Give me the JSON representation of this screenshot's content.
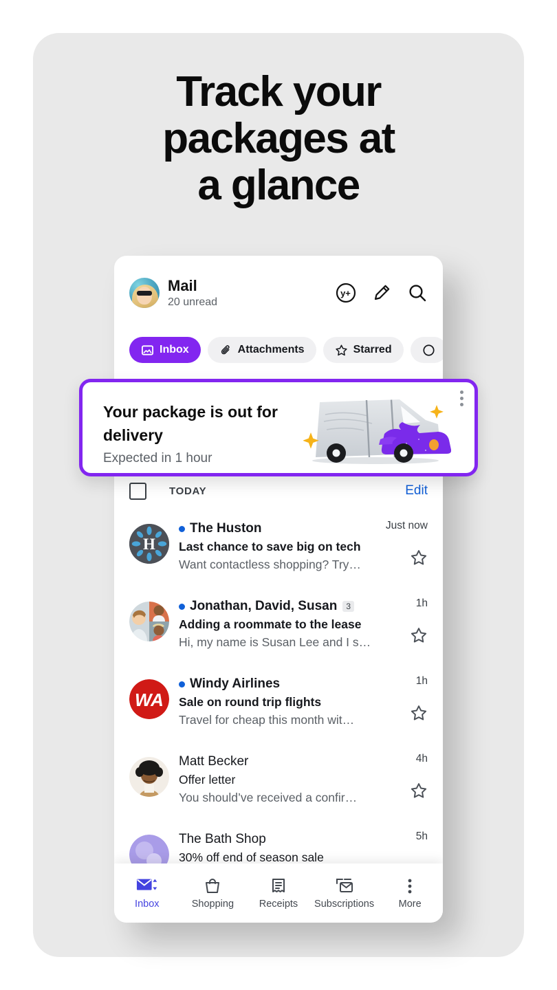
{
  "headline": {
    "lines": [
      "Track your",
      "packages at",
      "a glance"
    ]
  },
  "colors": {
    "panel_bg": "#e9e9e9",
    "accent_purple": "#8226f0",
    "tab_active": "#4443e0",
    "link_blue": "#1260d8",
    "unread_dot": "#1060d8"
  },
  "mail_app": {
    "header": {
      "title": "Mail",
      "subtitle": "20 unread",
      "avatar_icon": "user-photo-avatar",
      "actions": [
        {
          "name": "yahoo-plus-icon",
          "label": "y+"
        },
        {
          "name": "compose-pencil-icon",
          "label": "Compose"
        },
        {
          "name": "search-icon",
          "label": "Search"
        }
      ]
    },
    "chips": [
      {
        "label": "Inbox",
        "icon": "inbox-photo-icon",
        "active": true
      },
      {
        "label": "Attachments",
        "icon": "paperclip-icon",
        "active": false
      },
      {
        "label": "Starred",
        "icon": "star-outline-icon",
        "active": false
      },
      {
        "label": "",
        "icon": "clock-circle-icon",
        "active": false
      }
    ],
    "list_header": {
      "select_all": "select-all-checkbox",
      "group_label": "TODAY",
      "edit_label": "Edit"
    },
    "messages": [
      {
        "sender": "The Huston",
        "subject": "Last chance to save big on tech",
        "snippet": "Want contactless shopping? Try…",
        "time": "Just now",
        "unread": true,
        "badge": "",
        "avatar": "huston-logo"
      },
      {
        "sender": "Jonathan, David, Susan",
        "subject": "Adding a roommate to the lease",
        "snippet": "Hi, my name is Susan Lee and I s…",
        "time": "1h",
        "unread": true,
        "badge": "3",
        "avatar": "group-photo-avatar"
      },
      {
        "sender": "Windy Airlines",
        "subject": "Sale on round trip flights",
        "snippet": "Travel for cheap this month wit…",
        "time": "1h",
        "unread": true,
        "badge": "",
        "avatar": "windy-airlines-logo"
      },
      {
        "sender": "Matt Becker",
        "subject": "Offer letter",
        "snippet": "You should’ve received a confir…",
        "time": "4h",
        "unread": false,
        "badge": "",
        "avatar": "matt-becker-photo"
      },
      {
        "sender": "The Bath Shop",
        "subject": "30% off end of season sale",
        "snippet": "",
        "time": "5h",
        "unread": false,
        "badge": "",
        "avatar": "bath-shop-logo"
      }
    ],
    "tabs": [
      {
        "label": "Inbox",
        "icon": "envelope-sort-icon",
        "active": true
      },
      {
        "label": "Shopping",
        "icon": "shopping-bag-icon",
        "active": false
      },
      {
        "label": "Receipts",
        "icon": "receipt-icon",
        "active": false
      },
      {
        "label": "Subscriptions",
        "icon": "subscriptions-envelope-icon",
        "active": false
      },
      {
        "label": "More",
        "icon": "more-dots-icon",
        "active": false
      }
    ]
  },
  "package_card": {
    "title": "Your package is out for delivery",
    "subtitle": "Expected in 1 hour",
    "menu_icon": "overflow-menu-icon",
    "illustration": "delivery-truck-illustration"
  }
}
